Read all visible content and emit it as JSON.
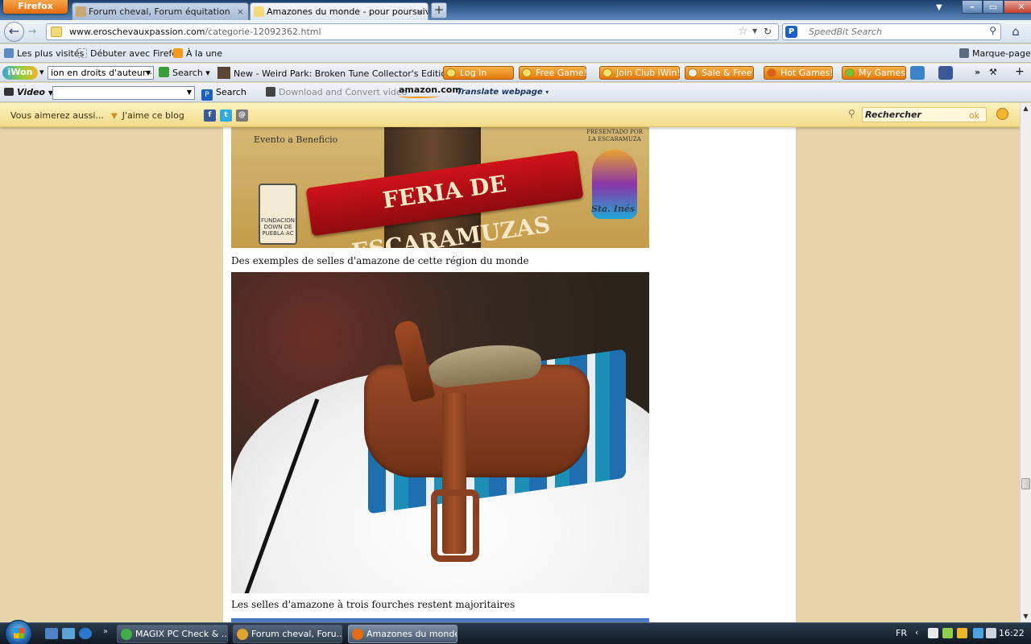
{
  "browser": {
    "menu_button": "Firefox",
    "tabs": [
      {
        "title": "Forum cheval, Forum équitation",
        "active": false
      },
      {
        "title": "Amazones du monde - pour poursuiv...",
        "active": true
      }
    ],
    "new_tab": "+",
    "window_controls": {
      "minimize": "–",
      "maximize": "▭",
      "close": "✕"
    }
  },
  "navbar": {
    "url_domain": "www.eroschevauxpassion.com",
    "url_path": "/categorie-12092362.html",
    "search_placeholder": "SpeedBit Search"
  },
  "bookmarks": {
    "items": [
      "Les plus visités",
      "Débuter avec Firefox",
      "À la une"
    ],
    "right": "Marque-pages"
  },
  "iwon_toolbar": {
    "logo": "iWon",
    "select_value": "ion en droits d'auteur -",
    "search": "Search",
    "game_title": "New - Weird Park: Broken Tune Collector's Edition",
    "buttons": [
      "Log In",
      "Free Game!",
      "Join Club iWin!",
      "Sale & Free",
      "Hot Games!",
      "My Games"
    ],
    "more": "»"
  },
  "video_toolbar": {
    "label": "Video",
    "search": "Search",
    "download": "Download and Convert video",
    "amazon": "amazon.com",
    "translate": "Translate webpage"
  },
  "blog_bar": {
    "suggest": "Vous aimerez aussi...",
    "like": "J'aime ce blog",
    "search_value": "Rechercher",
    "search_ok": "ok"
  },
  "article": {
    "image1": {
      "banner_text": "FERIA DE ESCARAMUZAS",
      "evento": "Evento a Beneficio",
      "fundacion": "FUNDACION DOWN DE PUEBLA AC",
      "presentado": "PRESENTADO POR LA ESCARAMUZA",
      "logo_name": "Sta. Inés"
    },
    "caption1": "Des exemples de selles d'amazone de cette région du monde",
    "caption2": "Les selles d'amazone à trois fourches restent majoritaires"
  },
  "taskbar": {
    "tasks": [
      {
        "label": "MAGIX PC Check & ...",
        "active": false
      },
      {
        "label": "Forum cheval, Foru...",
        "active": false
      },
      {
        "label": "Amazones du monde...",
        "active": true
      }
    ],
    "lang": "FR",
    "time": "16:22"
  },
  "colors": {
    "page_bg": "#e6d5a8",
    "blog_bar": "#f2dc8a",
    "firefox_orange": "#e56b10"
  }
}
